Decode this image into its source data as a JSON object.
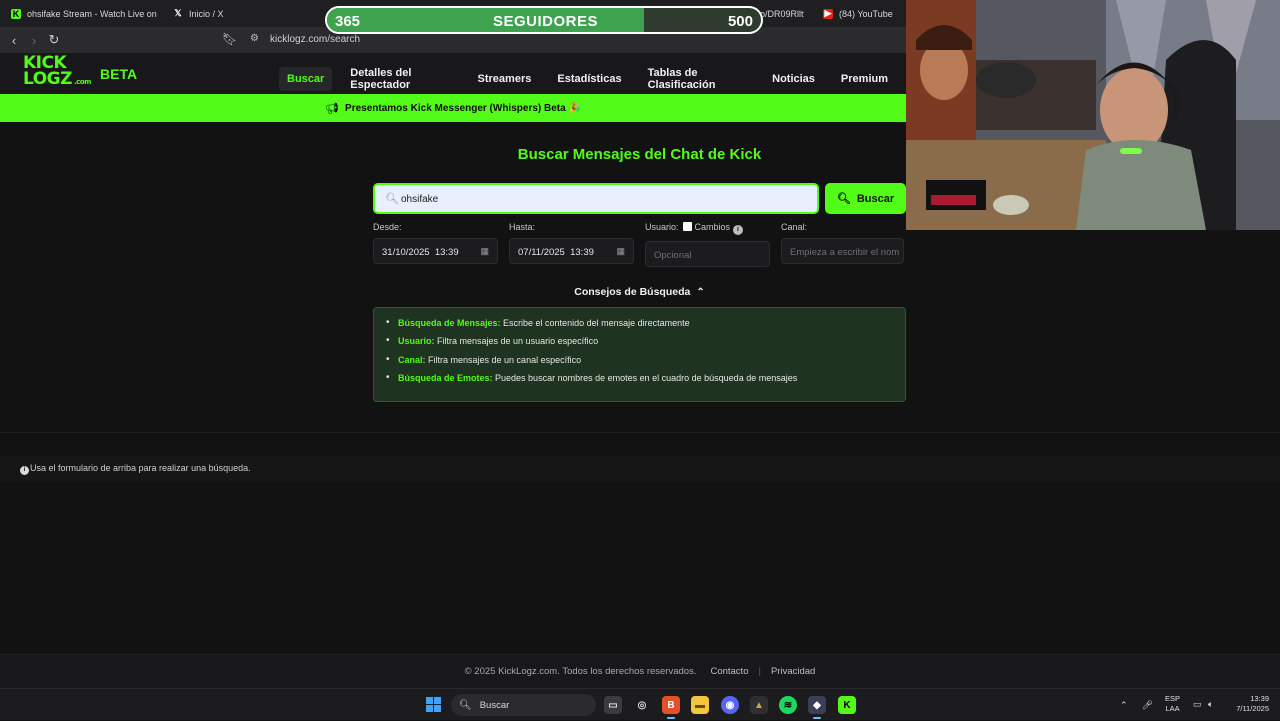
{
  "browser": {
    "tabs": [
      {
        "title": "ohsifake Stream - Watch Live on",
        "icon": "kick-favicon"
      },
      {
        "title": "Inicio / X",
        "icon": "x-favicon"
      },
      {
        "title": "taiko en X: \"https://t.co/DR09Rlltff\" /",
        "icon": "x-favicon"
      },
      {
        "title": "(84) YouTube",
        "icon": "youtube-favicon"
      }
    ],
    "url": "kicklogz.com/search"
  },
  "follower_goal": {
    "current": "365",
    "label": "SEGUIDORES",
    "goal": "500",
    "progress": 0.73,
    "fill_color": "#3da34f"
  },
  "site": {
    "logo_top": "KICK",
    "logo_bottom": "LOGZ",
    "logo_suffix": ".com",
    "beta": "BETA",
    "nav": [
      "Buscar",
      "Detalles del Espectador",
      "Streamers",
      "Estadísticas",
      "Tablas de Clasificación",
      "Noticias",
      "Premium"
    ],
    "announcement": "Presentamos Kick Messenger (Whispers) Beta 🎉",
    "accent_color": "#53fc18"
  },
  "search": {
    "heading": "Buscar Mensajes del Chat de Kick",
    "query": "ohsifake",
    "button_label": "Buscar",
    "from_label": "Desde:",
    "from_value": "31/10/2025  13:39",
    "to_label": "Hasta:",
    "to_value": "07/11/2025  13:39",
    "user_label": "Usuario:",
    "changes_label": "Cambios",
    "user_placeholder": "Opcional",
    "channel_label": "Canal:",
    "channel_placeholder": "Empieza a escribir el nom"
  },
  "tips": {
    "toggle_label": "Consejos de Búsqueda",
    "items": [
      {
        "key": "Búsqueda de Mensajes:",
        "text": " Escribe el contenido del mensaje directamente"
      },
      {
        "key": "Usuario:",
        "text": " Filtra mensajes de un usuario específico"
      },
      {
        "key": "Canal:",
        "text": " Filtra mensajes de un canal específico"
      },
      {
        "key": "Búsqueda de Emotes:",
        "text": " Puedes buscar nombres de emotes en el cuadro de búsqueda de mensajes"
      }
    ]
  },
  "results": {
    "empty_hint": "Usa el formulario de arriba para realizar una búsqueda."
  },
  "footer": {
    "copyright": "© 2025 KickLogz.com. Todos los derechos reservados.",
    "contact": "Contacto",
    "separator": "|",
    "privacy": "Privacidad"
  },
  "taskbar": {
    "search_label": "Buscar",
    "lang_top": "ESP",
    "lang_bottom": "LAA",
    "time": "13:39",
    "date": "7/11/2025"
  }
}
